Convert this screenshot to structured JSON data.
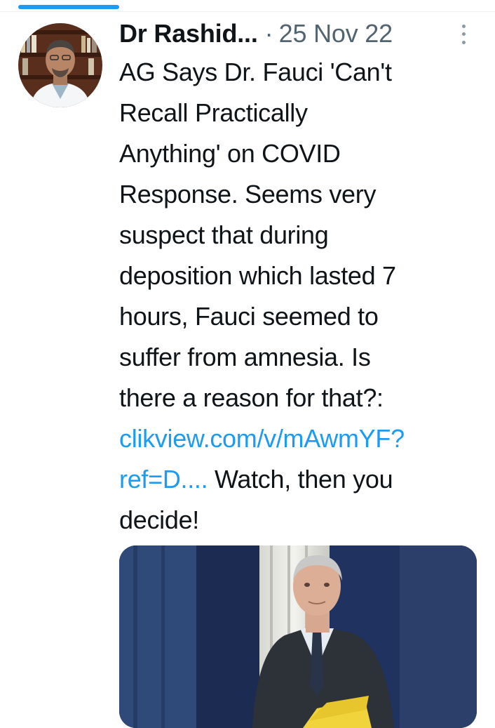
{
  "tabs": {
    "active_indicator_color": "#1d9bf0"
  },
  "tweet": {
    "author": {
      "display_name": "Dr Rashid...",
      "avatar_icon": "profile-photo"
    },
    "separator": "·",
    "timestamp": "25 Nov 22",
    "more_icon": "vertical-ellipsis-icon",
    "text_lines": [
      "AG Says Dr. Fauci 'Can't",
      "Recall Practically",
      "Anything' on COVID",
      "Response. Seems very",
      "suspect that during",
      "deposition which lasted 7",
      "hours, Fauci seemed to",
      "suffer from amnesia. Is",
      "there a reason for that?:"
    ],
    "link_line_1": "clikview.com/v/mAwmYF?",
    "link_line_2": "ref=D....",
    "after_link_text": " Watch, then you",
    "final_line": "decide!",
    "link_color": "#1d9bf0",
    "media": {
      "type": "photo",
      "icon": "photo-of-man-in-suit-holding-yellow-folder"
    }
  }
}
